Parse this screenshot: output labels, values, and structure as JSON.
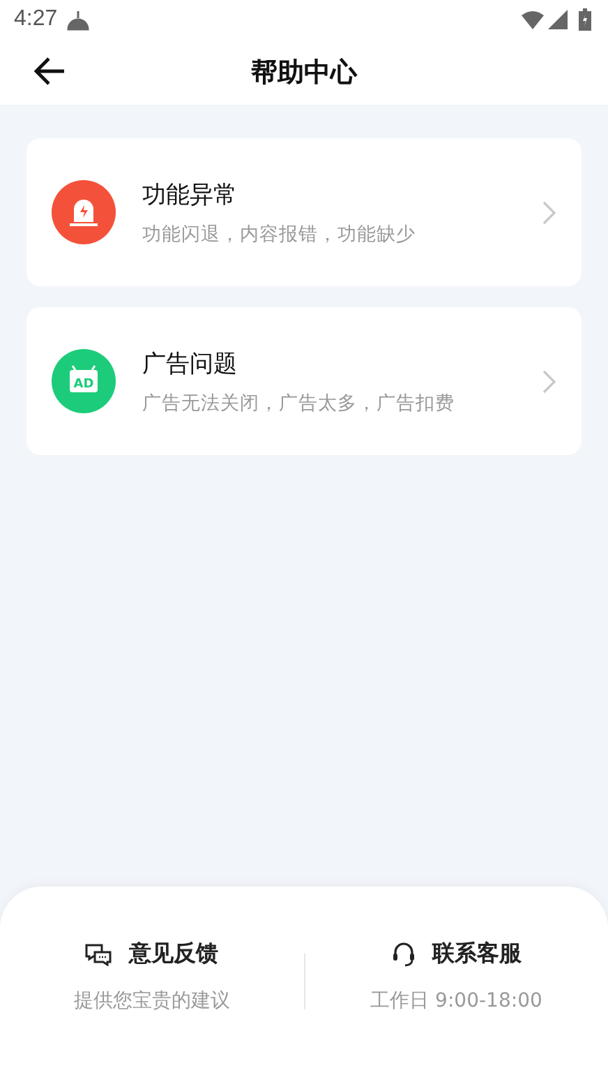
{
  "status_bar": {
    "time": "4:27"
  },
  "header": {
    "title": "帮助中心"
  },
  "topics": [
    {
      "kind": "malfunction",
      "color": "#f4513a",
      "title": "功能异常",
      "subtitle": "功能闪退，内容报错，功能缺少"
    },
    {
      "kind": "ad",
      "color": "#1ccc7a",
      "icon_text": "AD",
      "title": "广告问题",
      "subtitle": "广告无法关闭，广告太多，广告扣费"
    }
  ],
  "footer": [
    {
      "kind": "feedback",
      "title": "意见反馈",
      "subtitle": "提供您宝贵的建议"
    },
    {
      "kind": "service",
      "title": "联系客服",
      "subtitle": "工作日 9:00-18:00"
    }
  ]
}
